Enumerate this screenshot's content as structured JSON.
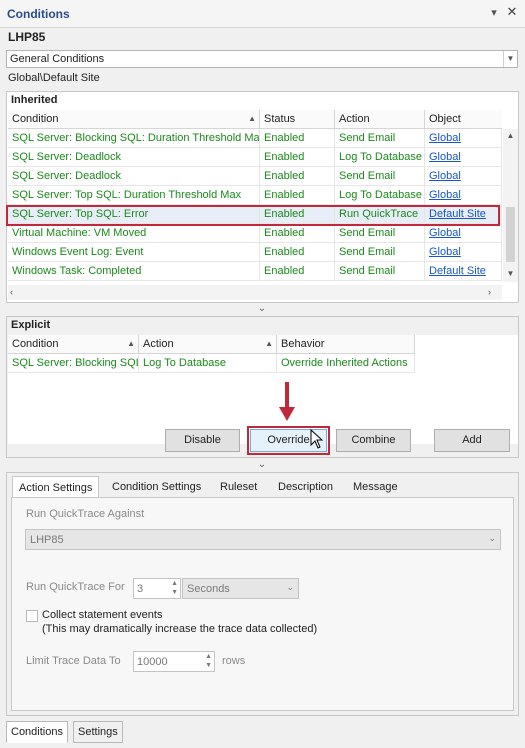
{
  "window": {
    "title": "Conditions",
    "pin_glyph": "▾",
    "close_glyph": "✕"
  },
  "host": "LHP85",
  "category_select": {
    "value": "General Conditions"
  },
  "path": "Global\\Default Site",
  "inherited": {
    "header": "Inherited",
    "columns": [
      "Condition",
      "Status",
      "Action",
      "Object"
    ],
    "rows": [
      [
        "SQL Server: Blocking SQL: Duration Threshold Max",
        "Enabled",
        "Send Email",
        "Global"
      ],
      [
        "SQL Server: Deadlock",
        "Enabled",
        "Log To Database",
        "Global"
      ],
      [
        "SQL Server: Deadlock",
        "Enabled",
        "Send Email",
        "Global"
      ],
      [
        "SQL Server: Top SQL: Duration Threshold Max",
        "Enabled",
        "Log To Database",
        "Global"
      ],
      [
        "SQL Server: Top SQL: Error",
        "Enabled",
        "Run QuickTrace",
        "Default Site"
      ],
      [
        "Virtual Machine: VM Moved",
        "Enabled",
        "Send Email",
        "Global"
      ],
      [
        "Windows Event Log: Event",
        "Enabled",
        "Send Email",
        "Global"
      ],
      [
        "Windows Task: Completed",
        "Enabled",
        "Send Email",
        "Default Site"
      ]
    ],
    "selected_index": 4
  },
  "explicit": {
    "header": "Explicit",
    "columns": [
      "Condition",
      "Action",
      "Behavior"
    ],
    "rows": [
      [
        "SQL Server: Blocking SQL",
        "Log To Database",
        "Override Inherited Actions"
      ]
    ]
  },
  "buttons": {
    "disable": "Disable",
    "override": "Override",
    "combine": "Combine",
    "add": "Add"
  },
  "tabs": [
    "Action Settings",
    "Condition Settings",
    "Ruleset",
    "Description",
    "Message"
  ],
  "action_settings": {
    "run_against_label": "Run QuickTrace Against",
    "run_against_value": "LHP85",
    "run_for_label": "Run QuickTrace For",
    "run_for_value": "3",
    "run_for_unit": "Seconds",
    "collect_label": "Collect statement events",
    "collect_note": "(This may dramatically increase the trace data collected)",
    "limit_label": "Limit Trace Data To",
    "limit_value": "10000",
    "limit_unit": "rows"
  },
  "bottom_tabs": [
    "Conditions",
    "Settings"
  ]
}
